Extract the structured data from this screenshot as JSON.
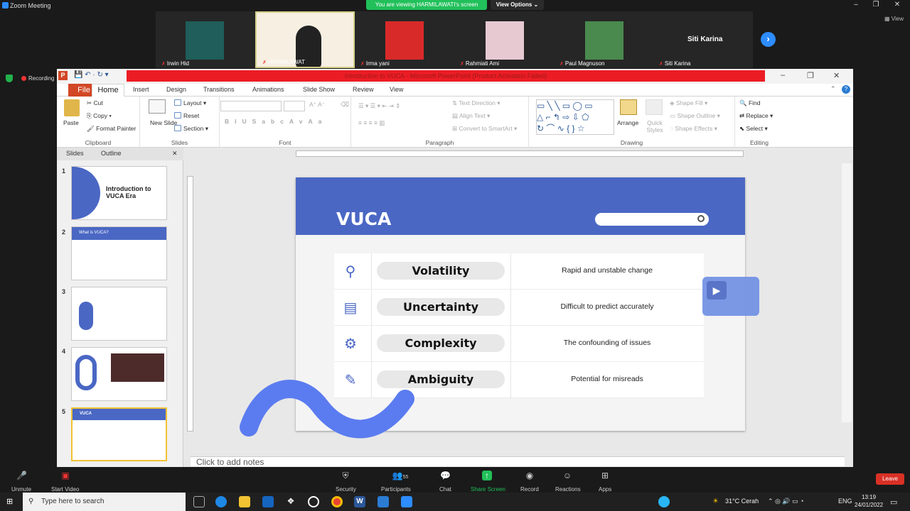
{
  "zoom": {
    "title": "Zoom Meeting",
    "viewing_banner": "You are viewing HARMILAWATI's screen",
    "view_options": "View Options",
    "view_label": "View",
    "recording": "Recording",
    "participants": [
      {
        "name": "Irwin Hid"
      },
      {
        "name": "HARMILAWAT"
      },
      {
        "name": "Irma yani"
      },
      {
        "name": "Rahmiati Ami"
      },
      {
        "name": "Paul Magnuson"
      },
      {
        "name": "Siti Karina"
      }
    ],
    "big_name": "Siti Karina",
    "toolbar": {
      "unmute": "Unmute",
      "start_video": "Start Video",
      "security": "Security",
      "participants": "Participants",
      "participants_count": "55",
      "chat": "Chat",
      "share_screen": "Share Screen",
      "record": "Record",
      "reactions": "Reactions",
      "apps": "Apps",
      "leave": "Leave"
    }
  },
  "ppt": {
    "title": "Introduction to VUCA  -  Microsoft PowerPoint (Product Activation Failed)",
    "tabs": [
      "File",
      "Home",
      "Insert",
      "Design",
      "Transitions",
      "Animations",
      "Slide Show",
      "Review",
      "View"
    ],
    "ribbon": {
      "clipboard": {
        "label": "Clipboard",
        "paste": "Paste",
        "cut": "Cut",
        "copy": "Copy",
        "format_painter": "Format Painter"
      },
      "slides": {
        "label": "Slides",
        "new_slide": "New Slide",
        "layout": "Layout",
        "reset": "Reset",
        "section": "Section"
      },
      "font": {
        "label": "Font"
      },
      "paragraph": {
        "label": "Paragraph",
        "text_direction": "Text Direction",
        "align_text": "Align Text",
        "convert": "Convert to SmartArt"
      },
      "drawing": {
        "label": "Drawing",
        "arrange": "Arrange",
        "quick_styles": "Quick Styles",
        "shape_fill": "Shape Fill",
        "shape_outline": "Shape Outline",
        "shape_effects": "Shape Effects"
      },
      "editing": {
        "label": "Editing",
        "find": "Find",
        "replace": "Replace",
        "select": "Select"
      }
    },
    "pane_tabs": {
      "slides": "Slides",
      "outline": "Outline"
    },
    "thumbnails": [
      {
        "num": "1",
        "title": "Introduction to VUCA Era"
      },
      {
        "num": "2",
        "title": "What is VUCA?"
      },
      {
        "num": "3",
        "title": ""
      },
      {
        "num": "4",
        "title": ""
      },
      {
        "num": "5",
        "title": "VUCA"
      }
    ],
    "slide": {
      "title": "VUCA",
      "rows": [
        {
          "term": "Volatility",
          "desc": "Rapid and unstable change",
          "icon": "search-icon"
        },
        {
          "term": "Uncertainty",
          "desc": "Difficult to predict accurately",
          "icon": "document-icon"
        },
        {
          "term": "Complexity",
          "desc": "The confounding of issues",
          "icon": "gears-icon"
        },
        {
          "term": "Ambiguity",
          "desc": "Potential for misreads",
          "icon": "edit-icon"
        }
      ]
    },
    "notes_placeholder": "Click to add notes"
  },
  "taskbar": {
    "search_placeholder": "Type here to search",
    "weather": "31°C  Cerah",
    "lang": "ENG",
    "time": "13:19",
    "date": "24/01/2022"
  },
  "colors": {
    "accent": "#4a67c4",
    "zoom_blue": "#2d8cff",
    "ppt_red": "#ec1c24",
    "file_tab": "#d24726"
  }
}
